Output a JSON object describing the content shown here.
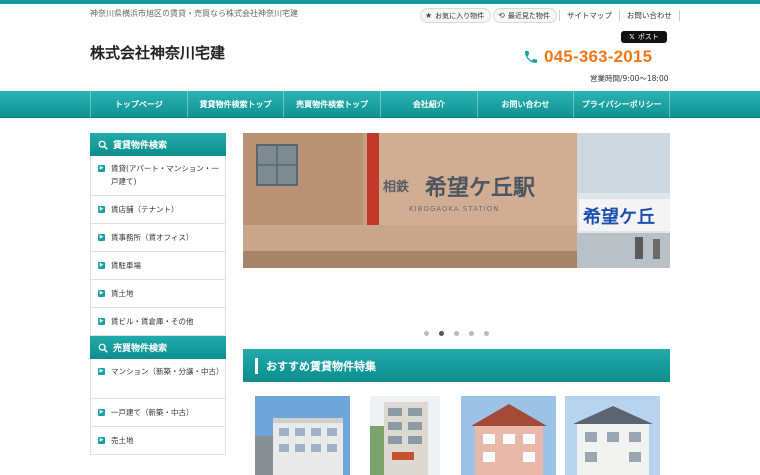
{
  "header": {
    "tagline": "神奈川県横浜市旭区の賃貸・売買なら株式会社神奈川宅建",
    "logo": "株式会社神奈川宅建",
    "favorites_label": "お気に入り物件",
    "recent_label": "最近見た物件",
    "sitemap_label": "サイトマップ",
    "contact_label": "お問い合わせ",
    "x_post_label": "ポスト",
    "phone": "045-363-2015",
    "hours": "営業時間/9:00～18:00"
  },
  "nav": {
    "items": [
      {
        "label": "トップページ"
      },
      {
        "label": "賃貸物件検索トップ"
      },
      {
        "label": "売買物件検索トップ"
      },
      {
        "label": "会社紹介"
      },
      {
        "label": "お問い合わせ"
      },
      {
        "label": "プライバシーポリシー"
      }
    ]
  },
  "sidebar": {
    "rental_heading": "賃貸物件検索",
    "rental_items": [
      {
        "label": "賃貸(アパート・マンション・一戸建て)"
      },
      {
        "label": "賃店舗（テナント）"
      },
      {
        "label": "賃事務所（賃オフィス）"
      },
      {
        "label": "賃駐車場"
      },
      {
        "label": "賃土地"
      },
      {
        "label": "賃ビル・賃倉庫・その他"
      }
    ],
    "sale_heading": "売買物件検索",
    "sale_items": [
      {
        "label": "マンション（新築・分譲・中古）"
      },
      {
        "label": "一戸建て（新築・中古）"
      },
      {
        "label": "売土地"
      }
    ]
  },
  "slider": {
    "station_sign_small": "相鉄",
    "station_sign_main": "希望ケ丘駅",
    "station_sign_roman": "KIBOGAOKA  STATION",
    "next_slide_text": "希望ケ丘",
    "dot_count": 5,
    "active_dot_index": 1
  },
  "featured": {
    "title": "おすすめ賃貸物件特集"
  },
  "colors": {
    "teal": "#139b9b",
    "orange": "#f07818"
  }
}
